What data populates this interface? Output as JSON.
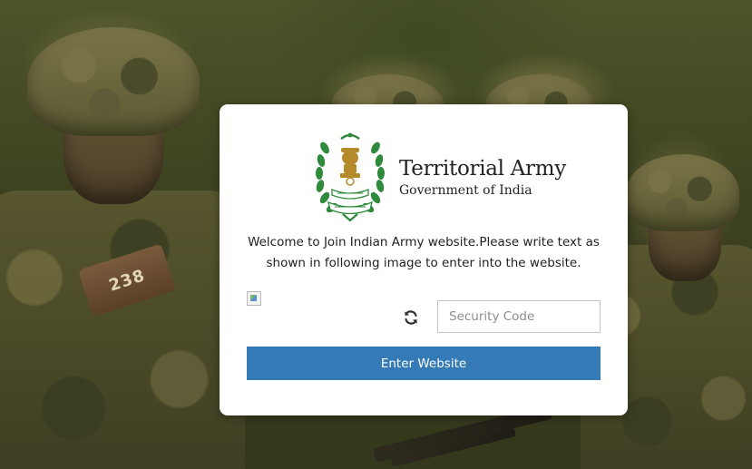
{
  "background": {
    "badge_text": "238"
  },
  "logo": {
    "emblem_icon": "territorial-army-emblem-icon",
    "title": "Territorial Army",
    "subtitle": "Government of India"
  },
  "welcome": {
    "line1": "Welcome to Join Indian Army website.Please write text as",
    "line2": "shown in following image to enter into the website."
  },
  "captcha": {
    "image_icon": "broken-image-icon",
    "refresh_icon": "refresh-icon"
  },
  "security_field": {
    "placeholder": "Security Code",
    "value": ""
  },
  "enter_button": {
    "label": "Enter Website"
  },
  "colors": {
    "button": "#337ab7",
    "emblem_green": "#2f8a3c"
  }
}
